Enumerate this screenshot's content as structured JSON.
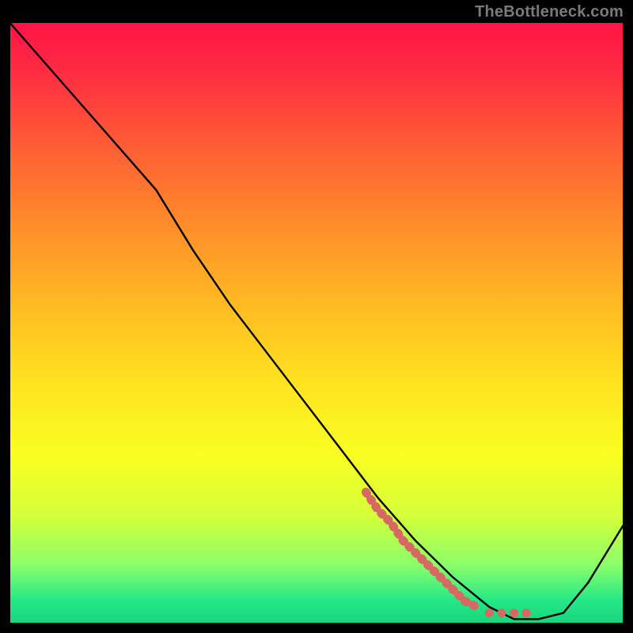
{
  "watermark": "TheBottleneck.com",
  "colors": {
    "curve": "#000000",
    "dotted": "#d66a62",
    "background_top": "#ff1246",
    "background_bottom": "#16d37d",
    "frame_border": "#000000"
  },
  "chart_data": {
    "type": "line",
    "title": "",
    "xlabel": "",
    "ylabel": "",
    "xlim": [
      0,
      100
    ],
    "ylim": [
      0,
      100
    ],
    "grid": false,
    "legend": false,
    "series": [
      {
        "name": "bottleneck-curve",
        "style": "solid",
        "x": [
          0,
          6,
          12,
          18,
          24,
          30,
          36,
          42,
          48,
          54,
          60,
          66,
          72,
          78,
          82,
          86,
          90,
          94,
          100
        ],
        "y": [
          100,
          93,
          86,
          79,
          72,
          62,
          53,
          45,
          37,
          29,
          21,
          14,
          8,
          3,
          1,
          1,
          2,
          7,
          17
        ]
      },
      {
        "name": "optimal-range-marker",
        "style": "dotted",
        "x": [
          58,
          60,
          62,
          64,
          66,
          68,
          70,
          72,
          74,
          76,
          78,
          80,
          82,
          84
        ],
        "y": [
          22,
          19,
          17,
          14,
          12,
          10,
          8,
          6,
          4,
          3,
          2,
          2,
          2,
          2
        ]
      }
    ]
  }
}
